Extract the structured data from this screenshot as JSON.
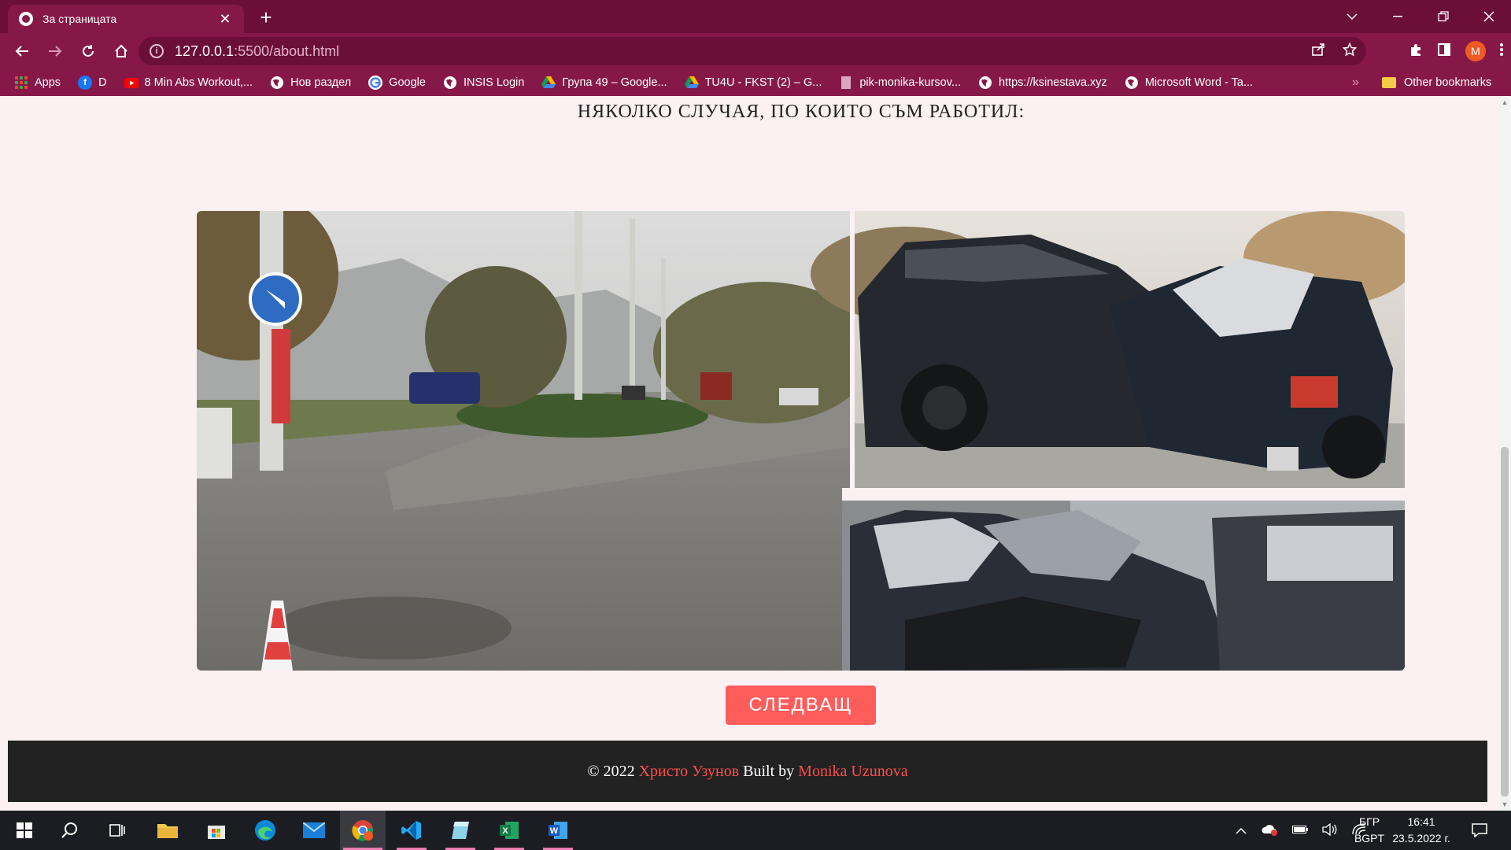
{
  "browser": {
    "tab_title": "За страницата",
    "tab_close": "✕",
    "new_tab": "+",
    "url_host": "127.0.0.1",
    "url_path": ":5500/about.html",
    "profile_initial": "M",
    "bookmarks": [
      {
        "label": "Apps",
        "icon": "apps-grid-icon",
        "color": "#e8453c"
      },
      {
        "label": "D",
        "icon": "facebook-icon",
        "color": "#1877f2"
      },
      {
        "label": "8 Min Abs Workout,...",
        "icon": "youtube-icon",
        "color": "#ff0000"
      },
      {
        "label": "Нов раздел",
        "icon": "globe-icon",
        "color": "#ffffff"
      },
      {
        "label": "Google",
        "icon": "google-icon",
        "color": "#ffffff"
      },
      {
        "label": "INSIS Login",
        "icon": "globe-icon",
        "color": "#ffffff"
      },
      {
        "label": "Група 49 – Google...",
        "icon": "google-drive-icon",
        "color": "#f4b400"
      },
      {
        "label": "TU4U - FKST (2) – G...",
        "icon": "google-drive-icon",
        "color": "#f4b400"
      },
      {
        "label": "pik-monika-kursov...",
        "icon": "page-icon",
        "color": "#c9a0b4"
      },
      {
        "label": "https://ksinestava.xyz",
        "icon": "globe-icon",
        "color": "#ffffff"
      },
      {
        "label": "Microsoft Word - Ta...",
        "icon": "globe-icon",
        "color": "#ffffff"
      }
    ],
    "bookmarks_more": "»",
    "other_bookmarks": "Other bookmarks"
  },
  "page": {
    "heading": "НЯКОЛКО СЛУЧАЯ, ПО КОИТО СЪМ РАБОТИЛ:",
    "next_button": "СЛЕДВАЩ",
    "footer": {
      "copyright": "© 2022 ",
      "author": "Христо Узунов",
      "built_by": " Built by ",
      "builder": "Monika Uzunova"
    }
  },
  "taskbar": {
    "apps": [
      "windows-start-icon",
      "search-icon",
      "task-view-icon",
      "file-explorer-icon",
      "microsoft-store-icon",
      "edge-icon",
      "mail-icon",
      "chrome-icon",
      "vscode-icon",
      "notepad-icon",
      "excel-icon",
      "word-icon"
    ],
    "lang_top": "БГР",
    "lang_bottom": "BGPT",
    "time": "16:41",
    "date": "23.5.2022 г."
  },
  "colors": {
    "chrome_dark": "#6b0e38",
    "chrome": "#861848",
    "page_bg": "#fbf0f2",
    "button": "#ff5c5c",
    "footer_bg": "#222222",
    "link": "#ff4d4d"
  }
}
